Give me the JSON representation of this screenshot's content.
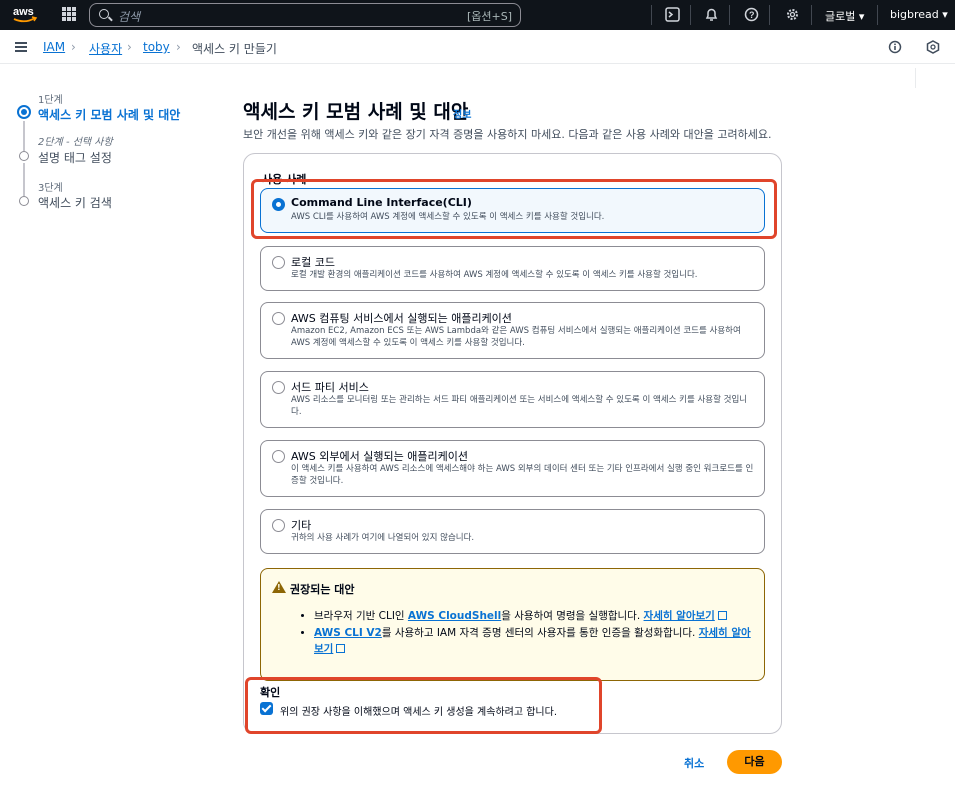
{
  "topnav": {
    "search_placeholder": "검색",
    "search_shortcut": "[옵션+S]",
    "region": "글로벌 ▾",
    "account": "bigbread ▾"
  },
  "breadcrumb": {
    "items": [
      "IAM",
      "사용자",
      "toby",
      "액세스 키 만들기"
    ]
  },
  "steps": [
    {
      "num": "1단계",
      "label": "액세스 키 모범 사례 및 대안"
    },
    {
      "num": "2단계 - 선택 사항",
      "label": "설명 태그 설정"
    },
    {
      "num": "3단계",
      "label": "액세스 키 검색"
    }
  ],
  "page": {
    "title": "액세스 키 모범 사례 및 대안",
    "info": "정보",
    "description": "보안 개선을 위해 액세스 키와 같은 장기 자격 증명을 사용하지 마세요. 다음과 같은 사용 사례와 대안을 고려하세요."
  },
  "use_case": {
    "label": "사용 사례",
    "options": [
      {
        "title": "Command Line Interface(CLI)",
        "desc": "AWS CLI를 사용하여 AWS 계정에 액세스할 수 있도록 이 액세스 키를 사용할 것입니다.",
        "selected": true
      },
      {
        "title": "로컬 코드",
        "desc": "로컬 개발 환경의 애플리케이션 코드를 사용하여 AWS 계정에 액세스할 수 있도록 이 액세스 키를 사용할 것입니다.",
        "selected": false
      },
      {
        "title": "AWS 컴퓨팅 서비스에서 실행되는 애플리케이션",
        "desc": "Amazon EC2, Amazon ECS 또는 AWS Lambda와 같은 AWS 컴퓨팅 서비스에서 실행되는 애플리케이션 코드를 사용하여 AWS 계정에 액세스할 수 있도록 이 액세스 키를 사용할 것입니다.",
        "selected": false
      },
      {
        "title": "서드 파티 서비스",
        "desc": "AWS 리소스를 모니터링 또는 관리하는 서드 파티 애플리케이션 또는 서비스에 액세스할 수 있도록 이 액세스 키를 사용할 것입니다.",
        "selected": false
      },
      {
        "title": "AWS 외부에서 실행되는 애플리케이션",
        "desc": "이 액세스 키를 사용하여 AWS 리소스에 액세스해야 하는 AWS 외부의 데이터 센터 또는 기타 인프라에서 실행 중인 워크로드를 인증할 것입니다.",
        "selected": false
      },
      {
        "title": "기타",
        "desc": "귀하의 사용 사례가 여기에 나열되어 있지 않습니다.",
        "selected": false
      }
    ]
  },
  "alert": {
    "title": "권장되는 대안",
    "item1_pre": "브라우저 기반 CLI인 ",
    "item1_link": "AWS CloudShell",
    "item1_mid": "을 사용하여 명령을 실행합니다. ",
    "item1_more": "자세히 알아보기",
    "item2_link": "AWS CLI V2",
    "item2_mid": "를 사용하고 IAM 자격 증명 센터의 사용자를 통한 인증을 활성화합니다. ",
    "item2_more": "자세히 알아보기"
  },
  "confirm": {
    "heading": "확인",
    "checkbox_label": "위의 권장 사항을 이해했으며 액세스 키 생성을 계속하려고 합니다.",
    "checked": true
  },
  "footer": {
    "cancel": "취소",
    "next": "다음"
  },
  "colors": {
    "accent": "#0972d3",
    "primary_button": "#ff9900",
    "highlight": "#e0452b",
    "topbar": "#0f141a"
  }
}
